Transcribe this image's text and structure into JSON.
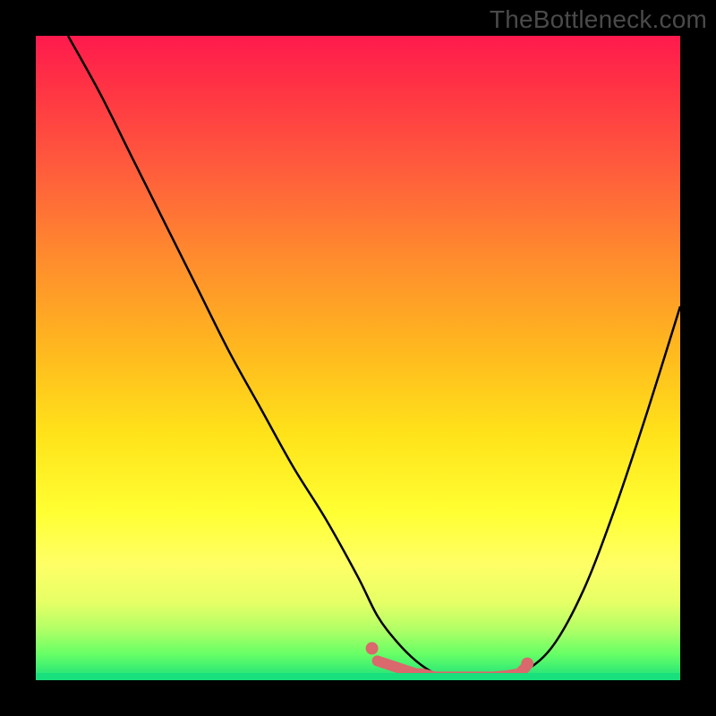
{
  "watermark": "TheBottleneck.com",
  "colors": {
    "background": "#000000",
    "gradient_stops": [
      "#ff1a4d",
      "#ff3344",
      "#ff5a3d",
      "#ff8a2e",
      "#ffb61f",
      "#ffe31a",
      "#ffff33",
      "#ffff66",
      "#e6ff66",
      "#b3ff66",
      "#66ff66",
      "#18e07c"
    ],
    "curve": "#000000",
    "markers": "#d9696c",
    "watermark_text": "#4a4a4a"
  },
  "chart_data": {
    "type": "line",
    "title": "",
    "xlabel": "",
    "ylabel": "",
    "xlim": [
      0,
      100
    ],
    "ylim": [
      0,
      100
    ],
    "grid": false,
    "legend": false,
    "series": [
      {
        "name": "bottleneck-curve",
        "x": [
          5,
          10,
          15,
          20,
          25,
          30,
          35,
          40,
          45,
          50,
          53,
          56,
          59,
          62,
          65,
          70,
          75,
          80,
          85,
          90,
          95,
          100
        ],
        "y": [
          100,
          91,
          81,
          71,
          61,
          51,
          42,
          33,
          25,
          16,
          10,
          6,
          3,
          1,
          0,
          0,
          1,
          5,
          14,
          27,
          42,
          58
        ]
      }
    ],
    "markers": {
      "name": "highlight-band",
      "x": [
        53,
        56,
        59,
        60,
        62,
        63,
        65,
        67,
        69,
        71,
        73,
        75,
        76
      ],
      "y": [
        3,
        2,
        1,
        1,
        0.5,
        0.5,
        0.5,
        0.5,
        0.5,
        0.5,
        0.7,
        1,
        2
      ]
    }
  }
}
